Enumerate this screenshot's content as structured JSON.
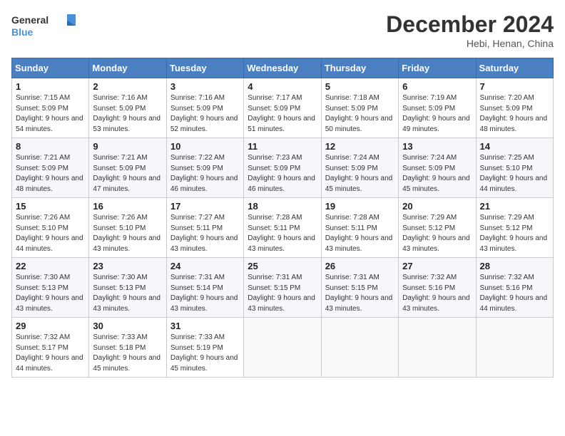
{
  "header": {
    "logo_line1": "General",
    "logo_line2": "Blue",
    "month": "December 2024",
    "location": "Hebi, Henan, China"
  },
  "weekdays": [
    "Sunday",
    "Monday",
    "Tuesday",
    "Wednesday",
    "Thursday",
    "Friday",
    "Saturday"
  ],
  "weeks": [
    [
      {
        "day": "1",
        "sunrise": "Sunrise: 7:15 AM",
        "sunset": "Sunset: 5:09 PM",
        "daylight": "Daylight: 9 hours and 54 minutes."
      },
      {
        "day": "2",
        "sunrise": "Sunrise: 7:16 AM",
        "sunset": "Sunset: 5:09 PM",
        "daylight": "Daylight: 9 hours and 53 minutes."
      },
      {
        "day": "3",
        "sunrise": "Sunrise: 7:16 AM",
        "sunset": "Sunset: 5:09 PM",
        "daylight": "Daylight: 9 hours and 52 minutes."
      },
      {
        "day": "4",
        "sunrise": "Sunrise: 7:17 AM",
        "sunset": "Sunset: 5:09 PM",
        "daylight": "Daylight: 9 hours and 51 minutes."
      },
      {
        "day": "5",
        "sunrise": "Sunrise: 7:18 AM",
        "sunset": "Sunset: 5:09 PM",
        "daylight": "Daylight: 9 hours and 50 minutes."
      },
      {
        "day": "6",
        "sunrise": "Sunrise: 7:19 AM",
        "sunset": "Sunset: 5:09 PM",
        "daylight": "Daylight: 9 hours and 49 minutes."
      },
      {
        "day": "7",
        "sunrise": "Sunrise: 7:20 AM",
        "sunset": "Sunset: 5:09 PM",
        "daylight": "Daylight: 9 hours and 48 minutes."
      }
    ],
    [
      {
        "day": "8",
        "sunrise": "Sunrise: 7:21 AM",
        "sunset": "Sunset: 5:09 PM",
        "daylight": "Daylight: 9 hours and 48 minutes."
      },
      {
        "day": "9",
        "sunrise": "Sunrise: 7:21 AM",
        "sunset": "Sunset: 5:09 PM",
        "daylight": "Daylight: 9 hours and 47 minutes."
      },
      {
        "day": "10",
        "sunrise": "Sunrise: 7:22 AM",
        "sunset": "Sunset: 5:09 PM",
        "daylight": "Daylight: 9 hours and 46 minutes."
      },
      {
        "day": "11",
        "sunrise": "Sunrise: 7:23 AM",
        "sunset": "Sunset: 5:09 PM",
        "daylight": "Daylight: 9 hours and 46 minutes."
      },
      {
        "day": "12",
        "sunrise": "Sunrise: 7:24 AM",
        "sunset": "Sunset: 5:09 PM",
        "daylight": "Daylight: 9 hours and 45 minutes."
      },
      {
        "day": "13",
        "sunrise": "Sunrise: 7:24 AM",
        "sunset": "Sunset: 5:09 PM",
        "daylight": "Daylight: 9 hours and 45 minutes."
      },
      {
        "day": "14",
        "sunrise": "Sunrise: 7:25 AM",
        "sunset": "Sunset: 5:10 PM",
        "daylight": "Daylight: 9 hours and 44 minutes."
      }
    ],
    [
      {
        "day": "15",
        "sunrise": "Sunrise: 7:26 AM",
        "sunset": "Sunset: 5:10 PM",
        "daylight": "Daylight: 9 hours and 44 minutes."
      },
      {
        "day": "16",
        "sunrise": "Sunrise: 7:26 AM",
        "sunset": "Sunset: 5:10 PM",
        "daylight": "Daylight: 9 hours and 43 minutes."
      },
      {
        "day": "17",
        "sunrise": "Sunrise: 7:27 AM",
        "sunset": "Sunset: 5:11 PM",
        "daylight": "Daylight: 9 hours and 43 minutes."
      },
      {
        "day": "18",
        "sunrise": "Sunrise: 7:28 AM",
        "sunset": "Sunset: 5:11 PM",
        "daylight": "Daylight: 9 hours and 43 minutes."
      },
      {
        "day": "19",
        "sunrise": "Sunrise: 7:28 AM",
        "sunset": "Sunset: 5:11 PM",
        "daylight": "Daylight: 9 hours and 43 minutes."
      },
      {
        "day": "20",
        "sunrise": "Sunrise: 7:29 AM",
        "sunset": "Sunset: 5:12 PM",
        "daylight": "Daylight: 9 hours and 43 minutes."
      },
      {
        "day": "21",
        "sunrise": "Sunrise: 7:29 AM",
        "sunset": "Sunset: 5:12 PM",
        "daylight": "Daylight: 9 hours and 43 minutes."
      }
    ],
    [
      {
        "day": "22",
        "sunrise": "Sunrise: 7:30 AM",
        "sunset": "Sunset: 5:13 PM",
        "daylight": "Daylight: 9 hours and 43 minutes."
      },
      {
        "day": "23",
        "sunrise": "Sunrise: 7:30 AM",
        "sunset": "Sunset: 5:13 PM",
        "daylight": "Daylight: 9 hours and 43 minutes."
      },
      {
        "day": "24",
        "sunrise": "Sunrise: 7:31 AM",
        "sunset": "Sunset: 5:14 PM",
        "daylight": "Daylight: 9 hours and 43 minutes."
      },
      {
        "day": "25",
        "sunrise": "Sunrise: 7:31 AM",
        "sunset": "Sunset: 5:15 PM",
        "daylight": "Daylight: 9 hours and 43 minutes."
      },
      {
        "day": "26",
        "sunrise": "Sunrise: 7:31 AM",
        "sunset": "Sunset: 5:15 PM",
        "daylight": "Daylight: 9 hours and 43 minutes."
      },
      {
        "day": "27",
        "sunrise": "Sunrise: 7:32 AM",
        "sunset": "Sunset: 5:16 PM",
        "daylight": "Daylight: 9 hours and 43 minutes."
      },
      {
        "day": "28",
        "sunrise": "Sunrise: 7:32 AM",
        "sunset": "Sunset: 5:16 PM",
        "daylight": "Daylight: 9 hours and 44 minutes."
      }
    ],
    [
      {
        "day": "29",
        "sunrise": "Sunrise: 7:32 AM",
        "sunset": "Sunset: 5:17 PM",
        "daylight": "Daylight: 9 hours and 44 minutes."
      },
      {
        "day": "30",
        "sunrise": "Sunrise: 7:33 AM",
        "sunset": "Sunset: 5:18 PM",
        "daylight": "Daylight: 9 hours and 45 minutes."
      },
      {
        "day": "31",
        "sunrise": "Sunrise: 7:33 AM",
        "sunset": "Sunset: 5:19 PM",
        "daylight": "Daylight: 9 hours and 45 minutes."
      },
      null,
      null,
      null,
      null
    ]
  ]
}
